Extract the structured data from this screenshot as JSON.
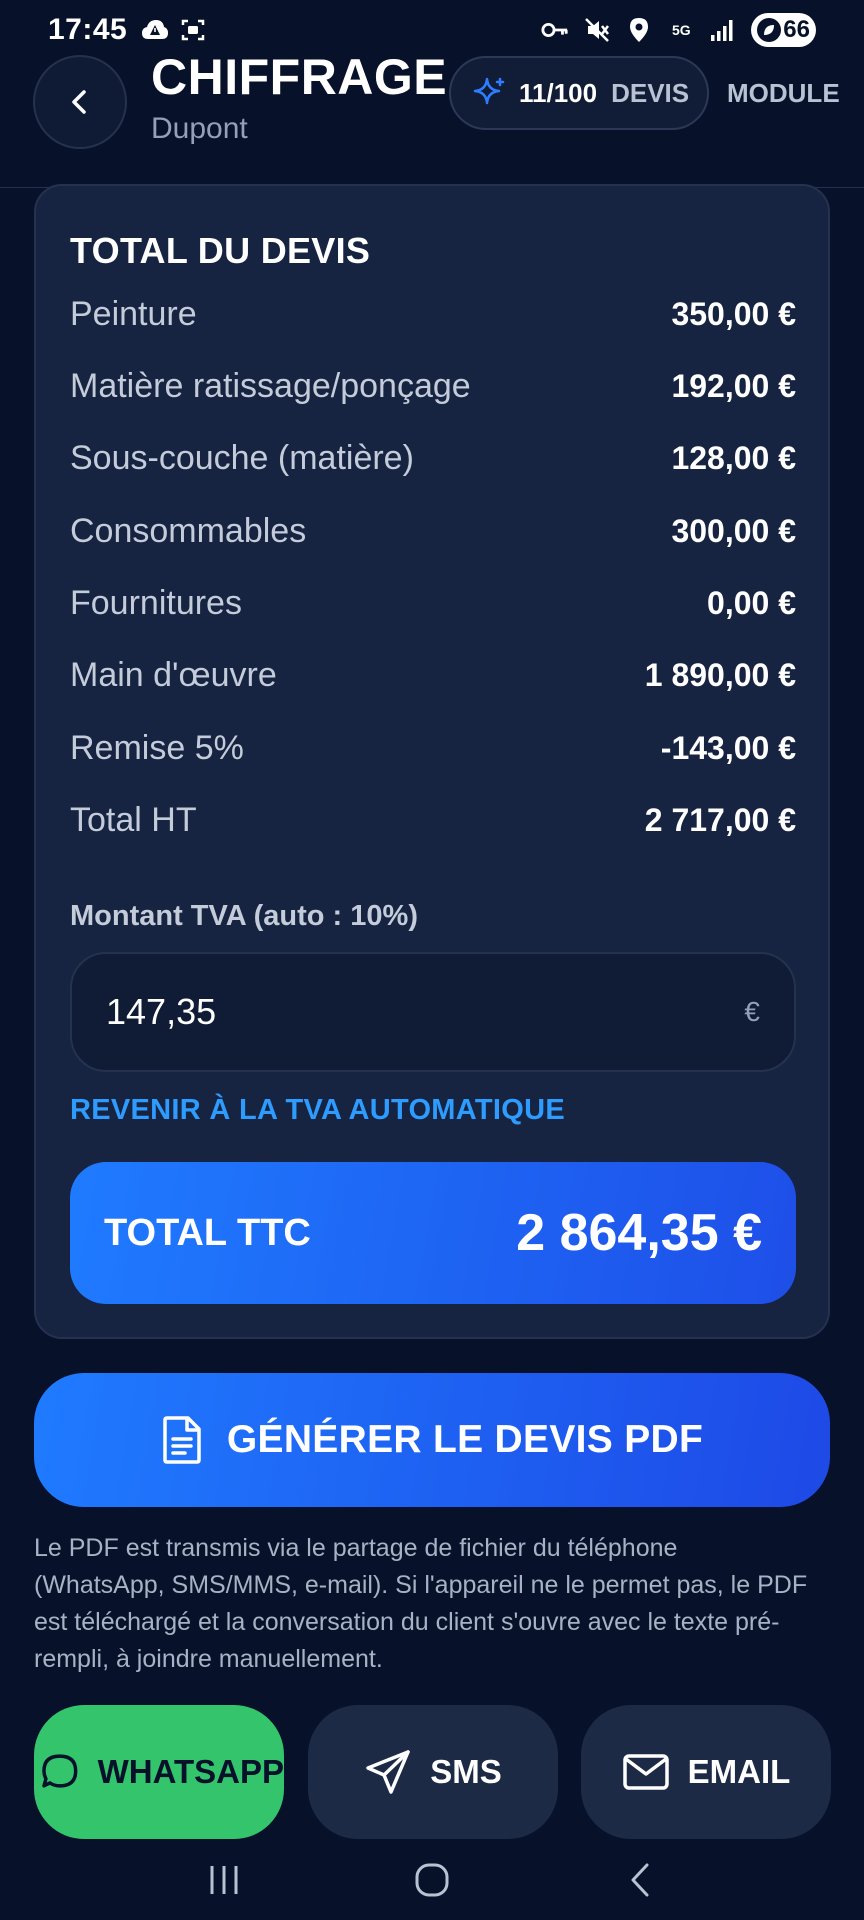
{
  "status_bar": {
    "time": "17:45",
    "network": "5G",
    "battery": "66",
    "left_icons": [
      "warning-cloud-icon",
      "screenshot-icon"
    ],
    "right_icons": [
      "vpn-key-icon",
      "mute-icon",
      "location-icon",
      "signal-icon",
      "battery-icon"
    ]
  },
  "header": {
    "title": "CHIFFRAGE ...",
    "subtitle": "Dupont",
    "quota_count": "11/100",
    "quota_label": "DEVIS",
    "module_label": "MODULE"
  },
  "summary": {
    "title": "TOTAL DU DEVIS",
    "lines": [
      {
        "label": "Peinture",
        "value": "350,00 €"
      },
      {
        "label": "Matière ratissage/ponçage",
        "value": "192,00 €"
      },
      {
        "label": "Sous-couche (matière)",
        "value": "128,00 €"
      },
      {
        "label": "Consommables",
        "value": "300,00 €"
      },
      {
        "label": "Fournitures",
        "value": "0,00 €"
      },
      {
        "label": "Main d'œuvre",
        "value": "1 890,00 €"
      },
      {
        "label": "Remise 5%",
        "value": "-143,00 €"
      },
      {
        "label": "Total HT",
        "value": "2 717,00 €"
      }
    ],
    "tva_label": "Montant TVA (auto : 10%)",
    "tva_value": "147,35",
    "tva_currency": "€",
    "revert_label": "REVENIR À LA TVA AUTOMATIQUE",
    "ttc_label": "TOTAL TTC",
    "ttc_value": "2 864,35 €"
  },
  "actions": {
    "generate_label": "GÉNÉRER LE DEVIS PDF",
    "info": "Le PDF est transmis via le partage de fichier du téléphone (WhatsApp, SMS/MMS, e-mail). Si l'appareil ne le permet pas, le PDF est téléchargé et la conversation du client s'ouvre avec le texte pré-rempli, à joindre manuellement.",
    "whatsapp_label": "WHATSAPP",
    "sms_label": "SMS",
    "email_label": "EMAIL"
  },
  "colors": {
    "background": "#07112a",
    "card": "#162341",
    "accent_blue": "#1f7bff",
    "link_blue": "#2e9bff",
    "whatsapp_green": "#34c46c"
  }
}
